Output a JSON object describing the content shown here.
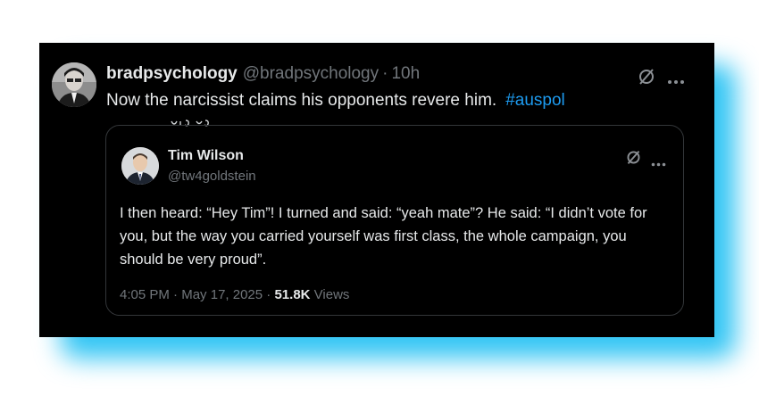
{
  "tweet": {
    "display_name": "bradpsychology",
    "handle": "@bradpsychology",
    "separator": "·",
    "time_ago": "10h",
    "text": "Now the narcissist claims his opponents revere him.",
    "hashtag": "#auspol"
  },
  "quoted": {
    "display_name": "Tim Wilson",
    "handle": "@tw4goldstein",
    "text": "I then heard: “Hey Tim”! I turned and said: “yeah mate”? He said: “I didn’t vote for you, but the way you carried yourself was first class, the whole campaign, you should be very proud”.",
    "time": "4:05 PM",
    "separator": "·",
    "date": "May 17, 2025",
    "views_count": "51.8K",
    "views_label": "Views"
  },
  "icons": {
    "grok": "grok-icon",
    "more": "more-options-icon"
  },
  "colors": {
    "background": "#000000",
    "text": "#e7e9ea",
    "muted": "#71767b",
    "link": "#1d9bf0",
    "glow": "#32c5f4",
    "border": "#333639"
  }
}
